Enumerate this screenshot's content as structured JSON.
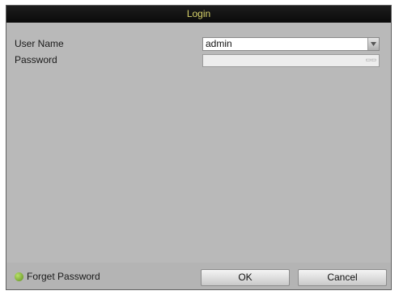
{
  "dialog": {
    "title": "Login",
    "fields": {
      "username_label": "User Name",
      "username_value": "admin",
      "password_label": "Password",
      "password_value": ""
    },
    "footer": {
      "forget_password_label": "Forget Password",
      "ok_label": "OK",
      "cancel_label": "Cancel"
    }
  },
  "icons": {
    "dropdown": "chevron-down-icon",
    "forget_password": "green-circle-icon",
    "keyboard": "keyboard-icon"
  },
  "colors": {
    "title_text": "#d8d36a",
    "title_bar": "#111111",
    "dialog_bg": "#b9b9b9",
    "forget_icon": "#7fb332"
  }
}
